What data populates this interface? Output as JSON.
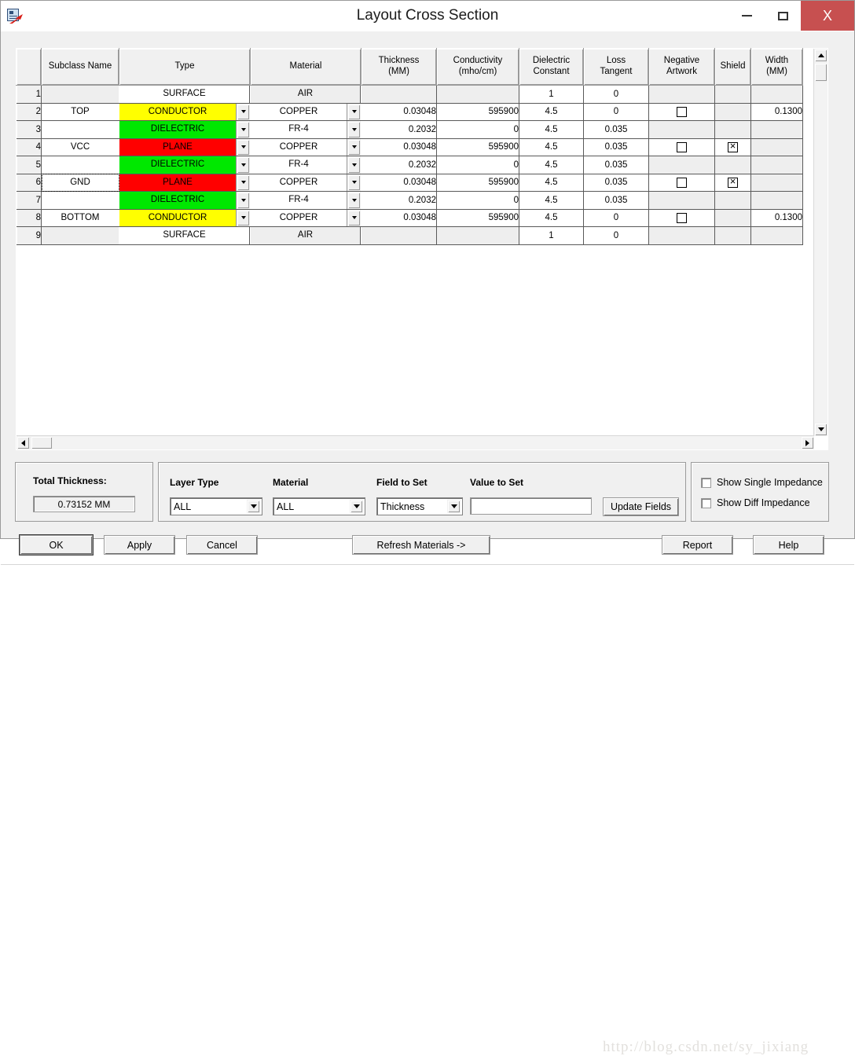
{
  "window": {
    "title": "Layout Cross Section",
    "icon": "app-icon",
    "minimize_label": "Minimize",
    "maximize_label": "Maximize",
    "close_label": "X"
  },
  "grid": {
    "columns": [
      {
        "key": "rownum",
        "label": ""
      },
      {
        "key": "subclass",
        "label": "Subclass Name"
      },
      {
        "key": "type",
        "label": "Type"
      },
      {
        "key": "material",
        "label": "Material"
      },
      {
        "key": "thickness",
        "label": "Thickness\n(MM)"
      },
      {
        "key": "conductivity",
        "label": "Conductivity\n(mho/cm)"
      },
      {
        "key": "dielectric",
        "label": "Dielectric\nConstant"
      },
      {
        "key": "loss",
        "label": "Loss\nTangent"
      },
      {
        "key": "negative",
        "label": "Negative\nArtwork"
      },
      {
        "key": "shield",
        "label": "Shield"
      },
      {
        "key": "width",
        "label": "Width\n(MM)"
      }
    ],
    "column_labels": {
      "subclass": "Subclass Name",
      "type": "Type",
      "material": "Material",
      "thickness_l1": "Thickness",
      "thickness_l2": "(MM)",
      "conductivity_l1": "Conductivity",
      "conductivity_l2": "(mho/cm)",
      "dielectric_l1": "Dielectric",
      "dielectric_l2": "Constant",
      "loss_l1": "Loss",
      "loss_l2": "Tangent",
      "negative_l1": "Negative",
      "negative_l2": "Artwork",
      "shield": "Shield",
      "width_l1": "Width",
      "width_l2": "(MM)"
    },
    "rows": [
      {
        "num": "1",
        "subclass": "",
        "type": "SURFACE",
        "type_fill": "none",
        "type_combo": false,
        "material": "AIR",
        "material_combo": false,
        "thickness": "",
        "conductivity": "",
        "dielectric": "1",
        "loss": "0",
        "negative": "none",
        "shield": "none",
        "width": "",
        "shaded": true,
        "focus": false
      },
      {
        "num": "2",
        "subclass": "TOP",
        "type": "CONDUCTOR",
        "type_fill": "conductor",
        "type_combo": true,
        "material": "COPPER",
        "material_combo": true,
        "thickness": "0.03048",
        "conductivity": "595900",
        "dielectric": "4.5",
        "loss": "0",
        "negative": "unchecked",
        "shield": "none",
        "width": "0.1300",
        "shaded": false,
        "focus": false
      },
      {
        "num": "3",
        "subclass": "",
        "type": "DIELECTRIC",
        "type_fill": "dielectric",
        "type_combo": true,
        "material": "FR-4",
        "material_combo": true,
        "thickness": "0.2032",
        "conductivity": "0",
        "dielectric": "4.5",
        "loss": "0.035",
        "negative": "none",
        "shield": "none",
        "width": "",
        "shaded": false,
        "focus": false
      },
      {
        "num": "4",
        "subclass": "VCC",
        "type": "PLANE",
        "type_fill": "plane",
        "type_combo": true,
        "material": "COPPER",
        "material_combo": true,
        "thickness": "0.03048",
        "conductivity": "595900",
        "dielectric": "4.5",
        "loss": "0.035",
        "negative": "unchecked",
        "shield": "checked",
        "width": "",
        "shaded": false,
        "focus": false
      },
      {
        "num": "5",
        "subclass": "",
        "type": "DIELECTRIC",
        "type_fill": "dielectric",
        "type_combo": true,
        "material": "FR-4",
        "material_combo": true,
        "thickness": "0.2032",
        "conductivity": "0",
        "dielectric": "4.5",
        "loss": "0.035",
        "negative": "none",
        "shield": "none",
        "width": "",
        "shaded": false,
        "focus": false
      },
      {
        "num": "6",
        "subclass": "GND",
        "type": "PLANE",
        "type_fill": "plane",
        "type_combo": true,
        "material": "COPPER",
        "material_combo": true,
        "thickness": "0.03048",
        "conductivity": "595900",
        "dielectric": "4.5",
        "loss": "0.035",
        "negative": "unchecked",
        "shield": "checked",
        "width": "",
        "shaded": false,
        "focus": true
      },
      {
        "num": "7",
        "subclass": "",
        "type": "DIELECTRIC",
        "type_fill": "dielectric",
        "type_combo": true,
        "material": "FR-4",
        "material_combo": true,
        "thickness": "0.2032",
        "conductivity": "0",
        "dielectric": "4.5",
        "loss": "0.035",
        "negative": "none",
        "shield": "none",
        "width": "",
        "shaded": false,
        "focus": false
      },
      {
        "num": "8",
        "subclass": "BOTTOM",
        "type": "CONDUCTOR",
        "type_fill": "conductor",
        "type_combo": true,
        "material": "COPPER",
        "material_combo": true,
        "thickness": "0.03048",
        "conductivity": "595900",
        "dielectric": "4.5",
        "loss": "0",
        "negative": "unchecked",
        "shield": "none",
        "width": "0.1300",
        "shaded": false,
        "focus": false
      },
      {
        "num": "9",
        "subclass": "",
        "type": "SURFACE",
        "type_fill": "none",
        "type_combo": false,
        "material": "AIR",
        "material_combo": false,
        "thickness": "",
        "conductivity": "",
        "dielectric": "1",
        "loss": "0",
        "negative": "none",
        "shield": "none",
        "width": "",
        "shaded": true,
        "focus": false
      }
    ]
  },
  "total_panel": {
    "label": "Total Thickness:",
    "value": "0.73152 MM"
  },
  "set_panel": {
    "layer_type_label": "Layer Type",
    "layer_type_value": "ALL",
    "material_label": "Material",
    "material_value": "ALL",
    "field_to_set_label": "Field to Set",
    "field_to_set_value": "Thickness",
    "value_to_set_label": "Value to Set",
    "value_to_set_value": "",
    "update_fields_label": "Update Fields"
  },
  "impedance_panel": {
    "show_single_label": "Show Single Impedance",
    "show_single_checked": false,
    "show_diff_label": "Show Diff Impedance",
    "show_diff_checked": false
  },
  "buttons": {
    "ok": "OK",
    "apply": "Apply",
    "cancel": "Cancel",
    "refresh_materials": "Refresh Materials ->",
    "report": "Report",
    "help": "Help"
  },
  "watermark": {
    "text": "http://blog.csdn.net/sy_jixiang"
  },
  "colors": {
    "conductor": "#ffff00",
    "dielectric": "#00e800",
    "plane": "#ff0000",
    "close_button": "#c75050",
    "dialog_face": "#f0f0f0"
  }
}
